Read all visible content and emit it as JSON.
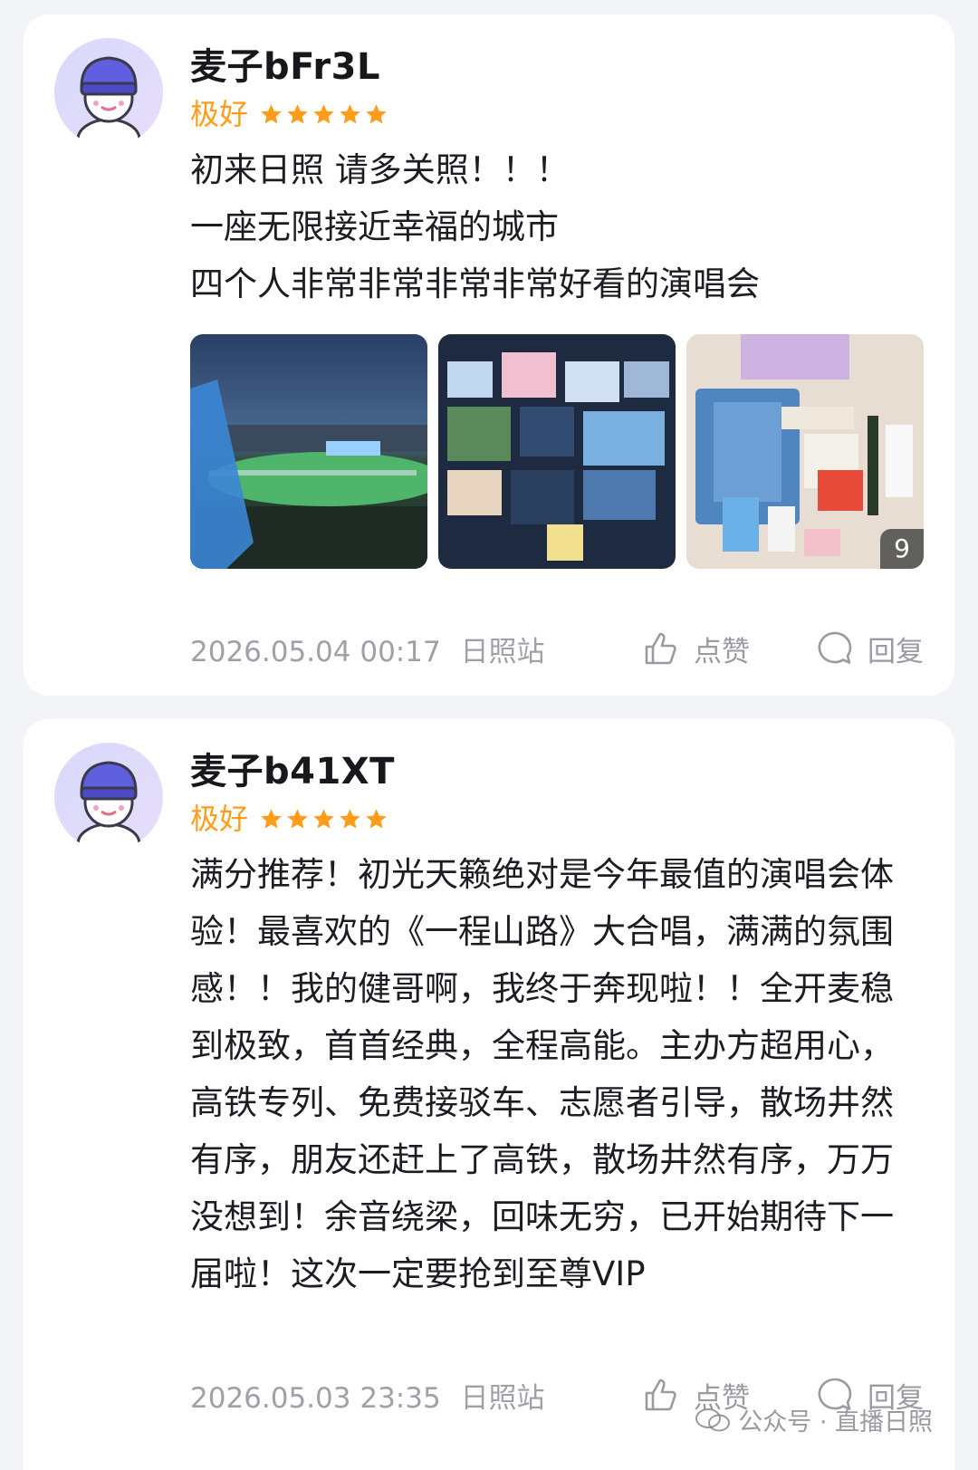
{
  "reviews": [
    {
      "username": "麦子bFr3L",
      "rating_label": "极好",
      "stars": 5,
      "text": "初来日照 请多关照！！！\n一座无限接近幸福的城市\n四个人非常非常非常非常好看的演唱会",
      "photo_count": "9",
      "datetime": "2026.05.04 00:17",
      "station": "日照站",
      "like_label": "点赞",
      "reply_label": "回复"
    },
    {
      "username": "麦子b41XT",
      "rating_label": "极好",
      "stars": 5,
      "text": "满分推荐！初光天籁绝对是今年最值的演唱会体验！最喜欢的《一程山路》大合唱，满满的氛围感！！我的健哥啊，我终于奔现啦！！全开麦稳到极致，首首经典，全程高能。主办方超用心，高铁专列、免费接驳车、志愿者引导，散场井然有序，朋友还赶上了高铁，散场井然有序，万万没想到！余音绕梁，回味无穷，已开始期待下一届啦！这次一定要抢到至尊VIP",
      "datetime": "2026.05.03 23:35",
      "station": "日照站",
      "like_label": "点赞",
      "reply_label": "回复"
    }
  ],
  "watermark": {
    "text": "公众号 · 直播日照"
  },
  "colors": {
    "accent_orange": "#ff9d1a",
    "star": "#ff9d1a",
    "avatar_cap": "#5f5fe0",
    "meta_gray": "#a0a0a8"
  },
  "icons": {
    "like": "thumbs-up-icon",
    "reply": "chat-bubble-icon",
    "star": "star-icon"
  }
}
